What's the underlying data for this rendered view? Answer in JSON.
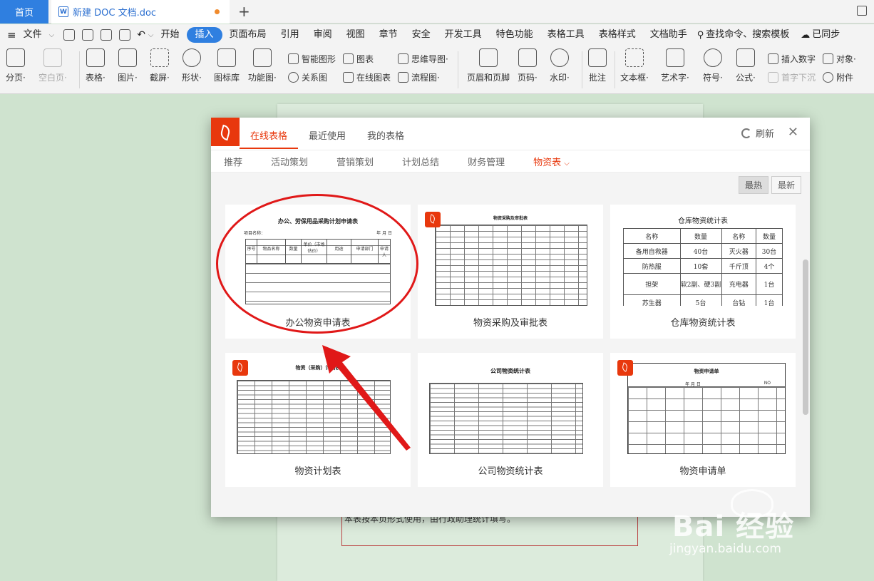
{
  "titlebar": {
    "home_tab": "首页",
    "doc_tab": "新建 DOC 文档.doc",
    "doc_icon": "W"
  },
  "menubar": {
    "file": "文件",
    "items": [
      "开始",
      "插入",
      "页面布局",
      "引用",
      "审阅",
      "视图",
      "章节",
      "安全",
      "开发工具",
      "特色功能",
      "表格工具",
      "表格样式",
      "文档助手"
    ],
    "active": "插入",
    "search": "查找命令、搜索模板",
    "sync": "已同步"
  },
  "ribbon": {
    "page_break": "分页·",
    "blank_page": "空白页·",
    "table": "表格·",
    "picture": "图片·",
    "screenshot": "截屏·",
    "shape": "形状·",
    "icon_lib": "图标库",
    "func_chart": "功能图·",
    "smart_shape": "智能图形",
    "chart": "图表",
    "mind_map": "思维导图·",
    "relation": "关系图",
    "online_chart": "在线图表",
    "flow_chart": "流程图·",
    "header_footer": "页眉和页脚",
    "page_num": "页码·",
    "watermark": "水印·",
    "comment": "批注",
    "textbox": "文本框·",
    "art_text": "艺术字·",
    "symbol": "符号·",
    "formula": "公式·",
    "insert_number": "插入数字",
    "object": "对象·",
    "dropcap": "首字下沉",
    "attachment": "附件"
  },
  "document": {
    "text": "本表按本页形式使用，由行政助理统计填写。"
  },
  "dialog": {
    "tabs": [
      "在线表格",
      "最近使用",
      "我的表格"
    ],
    "refresh": "刷新",
    "close": "✕",
    "categories": [
      "推荐",
      "活动策划",
      "营销策划",
      "计划总结",
      "财务管理",
      "物资表"
    ],
    "active_category": "物资表",
    "sort": {
      "hot": "最热",
      "new": "最新"
    },
    "cards": [
      {
        "title": "办公物资申请表",
        "thumb_title": "办公、劳保用品采购计划申请表",
        "thumb_sub": "项目名称：",
        "thumb_date": "年 月 日",
        "cols": [
          "序号",
          "物品名称",
          "数量",
          "单价（市场估价）",
          "用途",
          "申请部门",
          "申请人"
        ]
      },
      {
        "title": "物资采购及审批表",
        "thumb_title": "物资采购及审批表"
      },
      {
        "title": "仓库物资统计表",
        "thumb_title": "仓库物资统计表",
        "rows": [
          [
            "名称",
            "数量",
            "名称",
            "数量"
          ],
          [
            "备用自救器",
            "40台",
            "灭火器",
            "30台"
          ],
          [
            "防热服",
            "10套",
            "千斤顶",
            "4个"
          ],
          [
            "担架",
            "软2副、硬3副",
            "充电器",
            "1台"
          ],
          [
            "苏生器",
            "5台",
            "台钻",
            "1台"
          ]
        ]
      },
      {
        "title": "物资计划表",
        "thumb_title": "物资（采购）计划表"
      },
      {
        "title": "公司物资统计表",
        "thumb_title": "公司物资统计表"
      },
      {
        "title": "物资申请单",
        "thumb_title": "物资申请单",
        "thumb_date": "年 月 日",
        "thumb_no": "NO"
      }
    ]
  },
  "watermark": {
    "text": "Bai 经验",
    "url": "jingyan.baidu.com"
  },
  "colors": {
    "accent": "#e8380d",
    "tab_blue": "#2f7fe0",
    "annotation": "#e01818"
  }
}
